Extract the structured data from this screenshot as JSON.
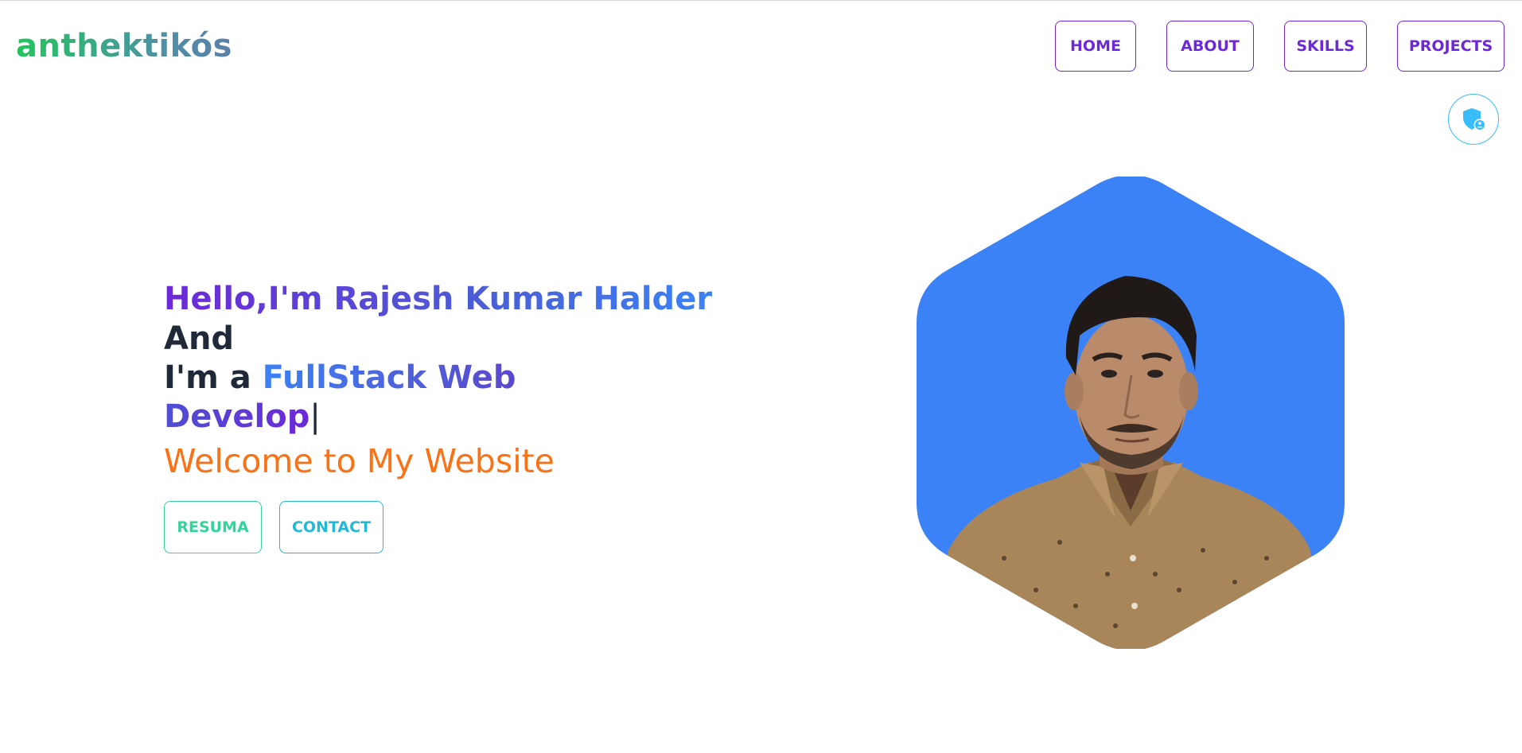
{
  "header": {
    "brand": "anthektikós",
    "nav": [
      {
        "label": "HOME"
      },
      {
        "label": "ABOUT"
      },
      {
        "label": "SKILLS"
      },
      {
        "label": "PROJECTS"
      }
    ],
    "shield_icon": "shield-user-icon"
  },
  "hero": {
    "greeting": "Hello,I'm Rajesh Kumar Halder",
    "line2": "And",
    "line3_prefix": "I'm a ",
    "role_part1": "FullStack Web",
    "role_part2": "Develop",
    "cursor": "|",
    "welcome": "Welcome to My Website",
    "buttons": {
      "resume": "RESUMA",
      "contact": "CONTACT"
    }
  },
  "colors": {
    "accent_purple": "#6d28d9",
    "accent_blue": "#3b82f6",
    "welcome_orange": "#f97316",
    "resume_green": "#34d399",
    "contact_cyan": "#22b8d6"
  }
}
